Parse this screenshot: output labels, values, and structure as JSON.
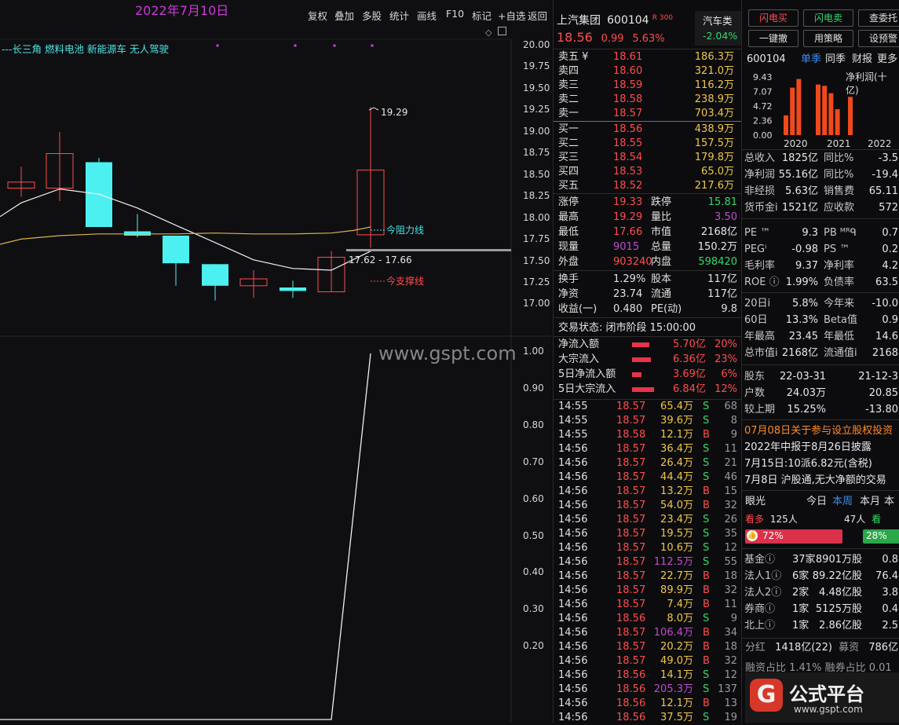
{
  "chart": {
    "date_label": "2022年7月10日",
    "concept_tags": "---长三角 燃料电池 新能源车 无人驾驶",
    "toolbar": [
      "复权",
      "叠加",
      "多股",
      "统计",
      "画线",
      "F10",
      "标记",
      "+自选",
      "返回"
    ],
    "y_ticks_upper": [
      "20.00",
      "19.75",
      "19.50",
      "19.25",
      "19.00",
      "18.75",
      "18.50",
      "18.25",
      "18.00",
      "17.75",
      "17.50",
      "17.25",
      "17.00"
    ],
    "y_ticks_lower": [
      "1.00",
      "0.90",
      "0.80",
      "0.70",
      "0.60",
      "0.50",
      "0.40",
      "0.30",
      "0.20"
    ],
    "high_label": "19.29",
    "resistance_label": "今阻力线",
    "range_label": "17.62 - 17.66",
    "support_label": "今支撑线",
    "watermark": "www.gspt.com"
  },
  "chart_data": {
    "type": "candlestick",
    "ylim": [
      16.8,
      20.2
    ],
    "candles": [
      {
        "open": 18.35,
        "close": 18.42,
        "high": 18.6,
        "low": 18.25,
        "color": "red"
      },
      {
        "open": 18.35,
        "close": 18.75,
        "high": 19.0,
        "low": 18.2,
        "color": "red"
      },
      {
        "open": 18.65,
        "close": 17.9,
        "high": 18.7,
        "low": 17.9,
        "color": "cyan"
      },
      {
        "open": 17.85,
        "close": 17.8,
        "high": 18.05,
        "low": 17.78,
        "color": "cyan"
      },
      {
        "open": 17.8,
        "close": 17.48,
        "high": 17.8,
        "low": 17.22,
        "color": "cyan"
      },
      {
        "open": 17.47,
        "close": 17.22,
        "high": 17.47,
        "low": 17.05,
        "color": "cyan"
      },
      {
        "open": 17.22,
        "close": 17.3,
        "high": 17.4,
        "low": 17.08,
        "color": "red"
      },
      {
        "open": 17.2,
        "close": 17.16,
        "high": 17.28,
        "low": 17.08,
        "color": "cyan"
      },
      {
        "open": 17.15,
        "close": 17.55,
        "high": 17.62,
        "low": 17.15,
        "color": "red"
      },
      {
        "open": 17.81,
        "close": 18.56,
        "high": 19.29,
        "low": 17.66,
        "color": "red"
      }
    ],
    "ma_white": [
      18.02,
      18.18,
      18.34,
      18.28,
      18.12,
      17.92,
      17.72,
      17.52,
      17.42,
      17.4,
      17.62
    ],
    "ma_yellow": [
      17.7,
      17.76,
      17.8,
      17.82,
      17.82,
      17.82,
      17.83,
      17.82,
      17.82,
      17.83,
      17.86,
      17.9
    ],
    "lower_series": [
      0,
      0,
      0,
      0,
      0,
      0,
      0,
      0,
      1.0
    ]
  },
  "quote": {
    "name": "上汽集团",
    "code": "600104",
    "badge": "R 300",
    "sector": "汽车类",
    "sector_change": "-2.04%",
    "price": "18.56",
    "change": "0.99",
    "change_pct": "5.63%",
    "sells": [
      {
        "label": "卖五 ¥",
        "price": "18.61",
        "vol": "186.3万"
      },
      {
        "label": "卖四",
        "price": "18.60",
        "vol": "321.0万"
      },
      {
        "label": "卖三",
        "price": "18.59",
        "vol": "116.2万"
      },
      {
        "label": "卖二",
        "price": "18.58",
        "vol": "238.9万"
      },
      {
        "label": "卖一",
        "price": "18.57",
        "vol": "703.4万"
      }
    ],
    "buys": [
      {
        "label": "买一",
        "price": "18.56",
        "vol": "438.9万"
      },
      {
        "label": "买二",
        "price": "18.55",
        "vol": "157.5万"
      },
      {
        "label": "买三",
        "price": "18.54",
        "vol": "179.8万"
      },
      {
        "label": "买四",
        "price": "18.53",
        "vol": "65.0万"
      },
      {
        "label": "买五",
        "price": "18.52",
        "vol": "217.6万"
      }
    ],
    "stats": [
      {
        "l1": "涨停",
        "v1": "19.33",
        "c1": "red",
        "l2": "跌停",
        "v2": "15.81",
        "c2": "green"
      },
      {
        "l1": "最高",
        "v1": "19.29",
        "c1": "red",
        "l2": "量比",
        "v2": "3.50",
        "c2": "purple"
      },
      {
        "l1": "最低",
        "v1": "17.66",
        "c1": "red",
        "l2": "市值",
        "v2": "2168亿",
        "c2": "white"
      },
      {
        "l1": "现量",
        "v1": "9015",
        "c1": "purple",
        "l2": "总量",
        "v2": "150.2万",
        "c2": "white"
      },
      {
        "l1": "外盘",
        "v1": "903240",
        "c1": "red",
        "l2": "内盘",
        "v2": "598420",
        "c2": "green"
      }
    ],
    "stats2": [
      {
        "l1": "换手",
        "v1": "1.29%",
        "l2": "股本",
        "v2": "117亿"
      },
      {
        "l1": "净资",
        "v1": "23.74",
        "l2": "流通",
        "v2": "117亿"
      },
      {
        "l1": "收益(一)",
        "v1": "0.480",
        "l2": "PE(动)",
        "v2": "9.8"
      }
    ],
    "trade_status": "交易状态: 闭市阶段 15:00:00",
    "flows": [
      {
        "label": "净流入额",
        "val": "5.70亿",
        "pct": "20%",
        "w": 22
      },
      {
        "label": "大宗流入",
        "val": "6.36亿",
        "pct": "23%",
        "w": 24
      },
      {
        "label": "5日净流入额",
        "val": "3.69亿",
        "pct": "6%",
        "w": 12
      },
      {
        "label": "5日大宗流入",
        "val": "6.84亿",
        "pct": "12%",
        "w": 28
      }
    ],
    "ticks": [
      [
        "14:55",
        "18.57",
        "65.4万",
        "S",
        "68"
      ],
      [
        "14:55",
        "18.57",
        "39.6万",
        "S",
        "8"
      ],
      [
        "14:55",
        "18.58",
        "12.1万",
        "B",
        "9"
      ],
      [
        "14:56",
        "18.57",
        "36.4万",
        "S",
        "11"
      ],
      [
        "14:56",
        "18.57",
        "26.4万",
        "S",
        "21"
      ],
      [
        "14:56",
        "18.57",
        "44.4万",
        "S",
        "46"
      ],
      [
        "14:56",
        "18.57",
        "13.2万",
        "B",
        "15"
      ],
      [
        "14:56",
        "18.57",
        "54.0万",
        "B",
        "32"
      ],
      [
        "14:56",
        "18.57",
        "23.4万",
        "S",
        "26"
      ],
      [
        "14:56",
        "18.57",
        "19.5万",
        "S",
        "35"
      ],
      [
        "14:56",
        "18.57",
        "10.6万",
        "S",
        "12"
      ],
      [
        "14:56",
        "18.57",
        "112.5万",
        "S",
        "55"
      ],
      [
        "14:56",
        "18.57",
        "22.7万",
        "B",
        "18"
      ],
      [
        "14:56",
        "18.57",
        "89.9万",
        "B",
        "32"
      ],
      [
        "14:56",
        "18.57",
        "7.4万",
        "B",
        "11"
      ],
      [
        "14:56",
        "18.56",
        "8.0万",
        "S",
        "9"
      ],
      [
        "14:56",
        "18.57",
        "106.4万",
        "B",
        "34"
      ],
      [
        "14:56",
        "18.57",
        "20.2万",
        "B",
        "18"
      ],
      [
        "14:56",
        "18.57",
        "49.0万",
        "B",
        "32"
      ],
      [
        "14:56",
        "18.56",
        "14.1万",
        "S",
        "12"
      ],
      [
        "14:56",
        "18.56",
        "205.3万",
        "S",
        "137"
      ],
      [
        "14:56",
        "18.56",
        "12.1万",
        "B",
        "13"
      ],
      [
        "14:56",
        "18.56",
        "37.5万",
        "S",
        "19"
      ]
    ]
  },
  "info": {
    "buttons": [
      "闪电买",
      "闪电卖",
      "查委托",
      "一键撤",
      "用策略",
      "设预警"
    ],
    "code": "600104",
    "tabs": [
      "单季",
      "同季",
      "财报",
      "更多"
    ],
    "profit_label": "净利润(十亿)",
    "y_ticks": [
      "9.43",
      "7.07",
      "4.72",
      "2.36",
      "0.00"
    ],
    "years": [
      "2020",
      "2021",
      "2022"
    ],
    "profit_bars": [
      3.2,
      7.7,
      9.1,
      0,
      0,
      8.2,
      8.0,
      6.8,
      4.2,
      0,
      6.2
    ],
    "fin_rows": [
      [
        "总收入",
        "1825亿",
        "同比%",
        "-3.5"
      ],
      [
        "净利润",
        "55.16亿",
        "同比%",
        "-19.4"
      ],
      [
        "非经损",
        "5.63亿",
        "销售费",
        "65.11"
      ],
      [
        "货币金i",
        "1521亿",
        "应收款",
        "572"
      ]
    ],
    "ratio_rows": [
      [
        "PE ™",
        "9.3",
        "PB ᴹᴿᑫ",
        "0.7"
      ],
      [
        "PEGⁱ",
        "-0.98",
        "PS ™",
        "0.2"
      ],
      [
        "毛利率",
        "9.37",
        "净利率",
        "4.2"
      ],
      [
        "ROE ⓘ",
        "1.99%",
        "负债率",
        "63.5"
      ]
    ],
    "perf_rows": [
      [
        "20日i",
        "5.8%",
        "今年来",
        "-10.0"
      ],
      [
        "60日",
        "13.3%",
        "Beta值",
        "0.9"
      ],
      [
        "年最高",
        "23.45",
        "年最低",
        "14.6"
      ],
      [
        "总市值i",
        "2168亿",
        "流通值i",
        "2168"
      ]
    ],
    "holder_rows": [
      [
        "股东",
        "22-03-31",
        "21-12-3"
      ],
      [
        "户数",
        "24.03万",
        "20.85"
      ],
      [
        "较上期",
        "15.25%",
        "-13.80"
      ]
    ],
    "news": [
      "07月08日关于参与设立股权投资",
      "2022年中报于8月26日披露",
      "7月15日:10派6.82元(含税)",
      "7月8日 沪股通,无大净额的交易"
    ],
    "vision_title": "眼光",
    "vision_tabs": [
      "今日",
      "本周",
      "本月",
      "本"
    ],
    "bull_label": "看多",
    "bull_count": "125人",
    "bear_count": "47人",
    "bear_label": "看",
    "bull_pct": "72%",
    "bear_pct": "28%",
    "inst_rows": [
      [
        "基金ⓘ",
        "37家",
        "8901万股",
        "0.8"
      ],
      [
        "法人1ⓘ",
        "6家",
        "89.22亿股",
        "76.4"
      ],
      [
        "法人2ⓘ",
        "2家",
        "4.48亿股",
        "3.8"
      ],
      [
        "券商ⓘ",
        "1家",
        "5125万股",
        "0.4"
      ],
      [
        "北上ⓘ",
        "1家",
        "2.86亿股",
        "2.5"
      ]
    ],
    "dividend_label": "分红",
    "dividend_val": "1418亿(22)",
    "raise_label": "募资",
    "raise_val": "786亿(",
    "margin_row": "融资占比  1.41%  融券占比  0.01",
    "logo_text": "公式平台",
    "logo_url": "www.gspt.com"
  }
}
